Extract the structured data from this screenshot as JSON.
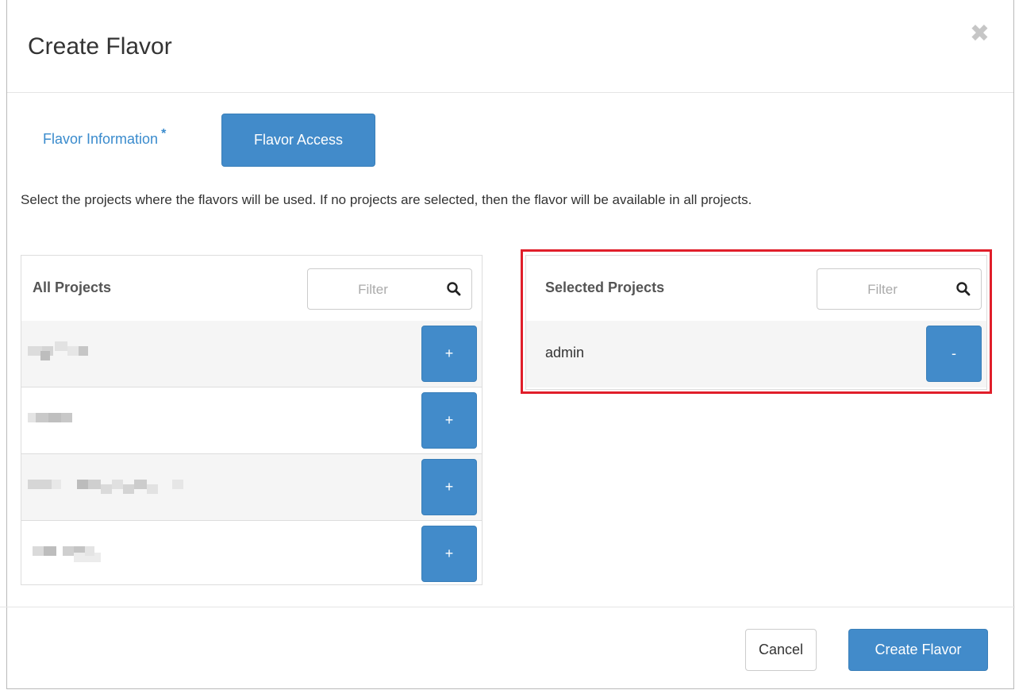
{
  "dialog": {
    "title": "Create Flavor",
    "close_glyph": "✖"
  },
  "tabs": [
    {
      "label": "Flavor Information",
      "required_marker": "*",
      "active": false
    },
    {
      "label": "Flavor Access",
      "active": true
    }
  ],
  "help_text": "Select the projects where the flavors will be used. If no projects are selected, then the flavor will be available in all projects.",
  "all_projects": {
    "title": "All Projects",
    "filter_placeholder": "Filter",
    "add_label": "+",
    "rows": [
      {
        "label": "",
        "redacted": true
      },
      {
        "label": "",
        "redacted": true
      },
      {
        "label": "",
        "redacted": true
      },
      {
        "label": "",
        "redacted": true
      }
    ]
  },
  "selected_projects": {
    "title": "Selected Projects",
    "filter_placeholder": "Filter",
    "remove_label": "-",
    "rows": [
      {
        "label": "admin"
      }
    ]
  },
  "footer": {
    "cancel_label": "Cancel",
    "create_label": "Create Flavor"
  },
  "colors": {
    "primary": "#428bca",
    "link": "#3a8bcd",
    "highlight": "#e01e2a"
  },
  "icons": {
    "search": "search-icon",
    "close": "close-icon"
  }
}
